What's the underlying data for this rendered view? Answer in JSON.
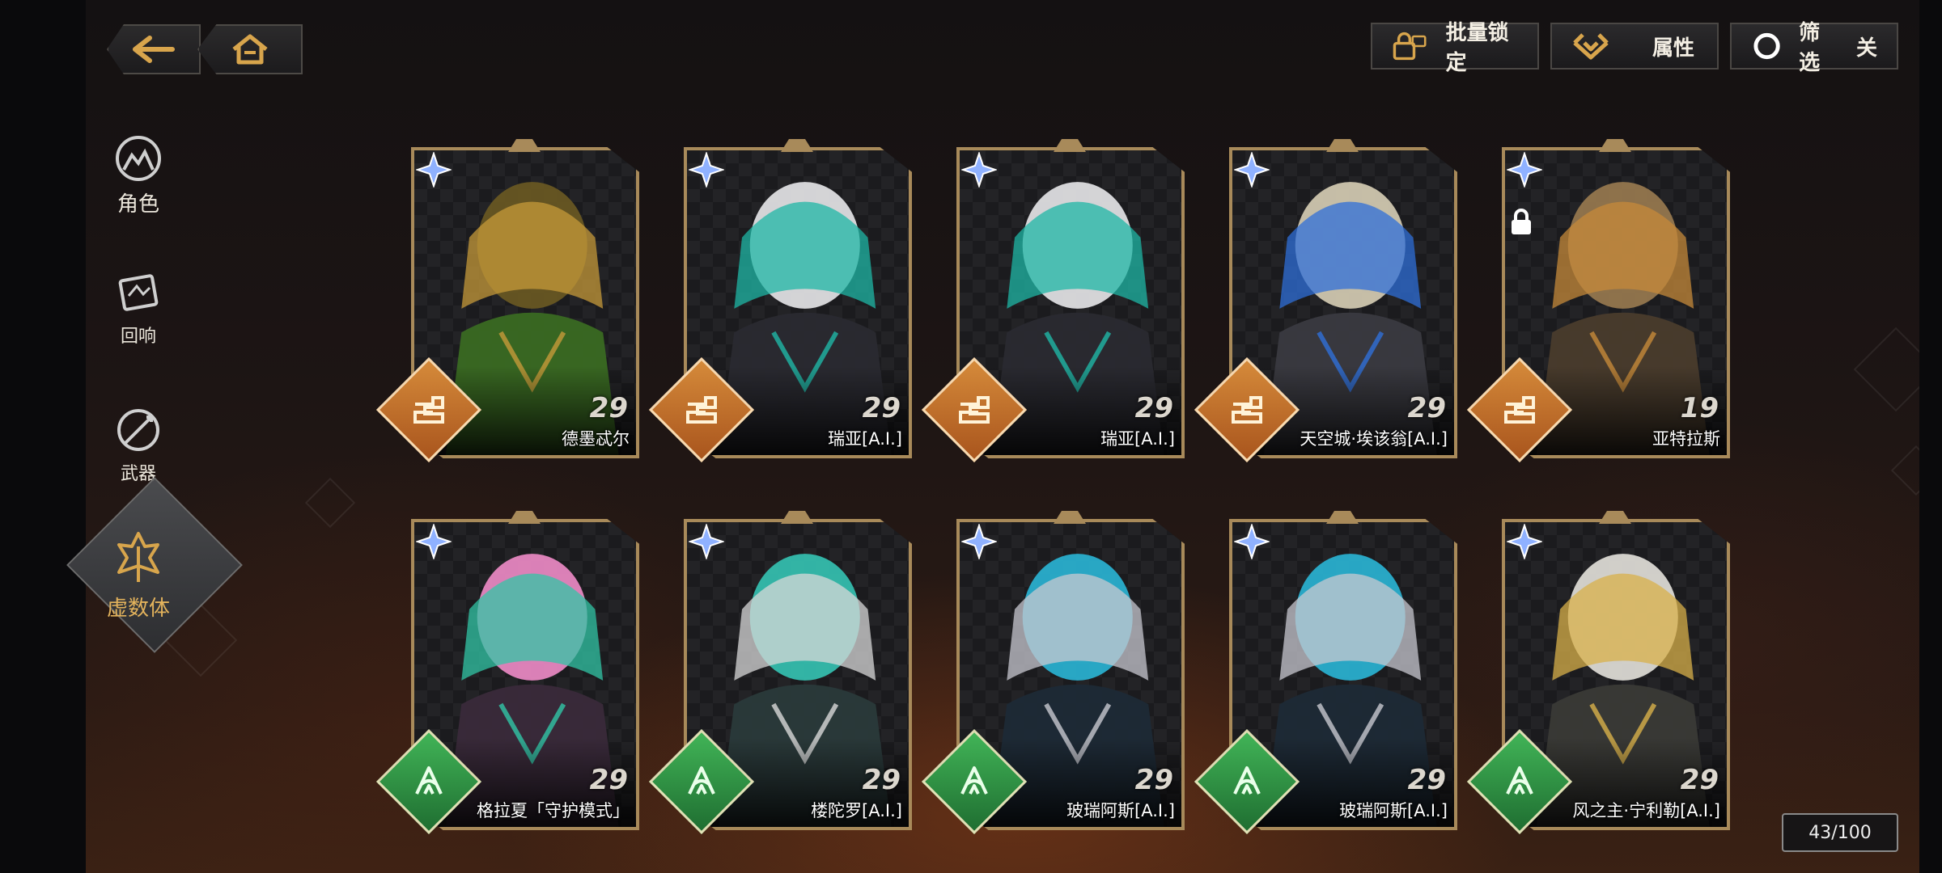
{
  "colors": {
    "card_frame": "#a88a5a",
    "element_gold": "#d58a3a",
    "element_green": "#41b457",
    "rarity_star": "#8fb1ff"
  },
  "toolbar": {
    "batch_lock_label": "批量锁定",
    "attribute_label": "属性",
    "filter_label": "筛选",
    "filter_state": "关"
  },
  "sidebar": {
    "items": [
      {
        "label": "角色",
        "icon": "character-icon"
      },
      {
        "label": "回响",
        "icon": "echo-icon"
      },
      {
        "label": "武器",
        "icon": "weapon-icon"
      },
      {
        "label": "虚数体",
        "icon": "imaginary-icon",
        "active": true
      }
    ]
  },
  "cards": [
    {
      "name": "德墨忒尔",
      "level": "29",
      "element": "gold",
      "locked": false
    },
    {
      "name": "瑞亚[A.I.]",
      "level": "29",
      "element": "gold",
      "locked": false
    },
    {
      "name": "瑞亚[A.I.]",
      "level": "29",
      "element": "gold",
      "locked": false
    },
    {
      "name": "天空城·埃该翁[A.I.]",
      "level": "29",
      "element": "gold",
      "locked": false
    },
    {
      "name": "亚特拉斯",
      "level": "19",
      "element": "gold",
      "locked": true
    },
    {
      "name": "格拉夏「守护模式」",
      "level": "29",
      "element": "green",
      "locked": false
    },
    {
      "name": "楼陀罗[A.I.]",
      "level": "29",
      "element": "green",
      "locked": false
    },
    {
      "name": "玻瑞阿斯[A.I.]",
      "level": "29",
      "element": "green",
      "locked": false
    },
    {
      "name": "玻瑞阿斯[A.I.]",
      "level": "29",
      "element": "green",
      "locked": false
    },
    {
      "name": "风之主·宁利勒[A.I.]",
      "level": "29",
      "element": "green",
      "locked": false
    }
  ],
  "counter": "43/100"
}
